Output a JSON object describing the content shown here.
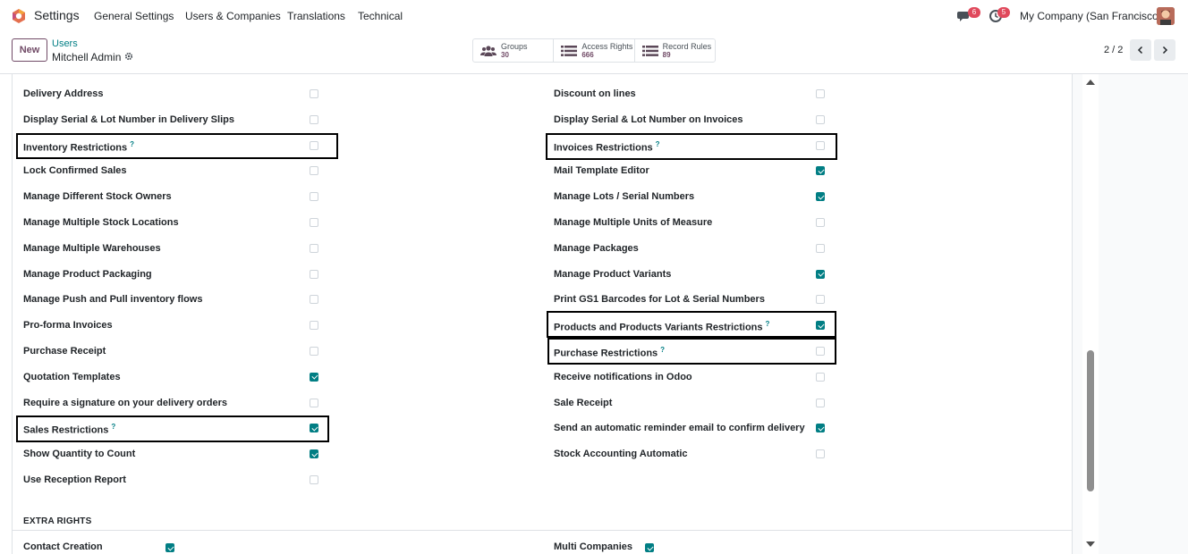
{
  "navbar": {
    "app_name": "Settings",
    "menu": [
      "General Settings",
      "Users & Companies",
      "Translations",
      "Technical"
    ],
    "messages_badge": "6",
    "activities_badge": "5",
    "company": "My Company (San Francisco)",
    "brand_color": "#714b67",
    "badge_color": "#e0495c"
  },
  "control_panel": {
    "new_label": "New",
    "breadcrumb": "Users",
    "record_name": "Mitchell Admin",
    "smart_buttons": [
      {
        "label": "Groups",
        "count": "30",
        "icon": "users-icon"
      },
      {
        "label": "Access Rights",
        "count": "666",
        "icon": "list-icon"
      },
      {
        "label": "Record Rules",
        "count": "89",
        "icon": "list-icon"
      }
    ],
    "pager": "2 / 2"
  },
  "accent_color": "#017e84",
  "left_fields": [
    {
      "label": "Delivery Address",
      "checked": false,
      "help": false
    },
    {
      "label": "Display Serial & Lot Number in Delivery Slips",
      "checked": false,
      "help": false
    },
    {
      "label": "Inventory Restrictions",
      "checked": false,
      "help": true
    },
    {
      "label": "Lock Confirmed Sales",
      "checked": false,
      "help": false
    },
    {
      "label": "Manage Different Stock Owners",
      "checked": false,
      "help": false
    },
    {
      "label": "Manage Multiple Stock Locations",
      "checked": false,
      "help": false
    },
    {
      "label": "Manage Multiple Warehouses",
      "checked": false,
      "help": false
    },
    {
      "label": "Manage Product Packaging",
      "checked": false,
      "help": false
    },
    {
      "label": "Manage Push and Pull inventory flows",
      "checked": false,
      "help": false
    },
    {
      "label": "Pro-forma Invoices",
      "checked": false,
      "help": false
    },
    {
      "label": "Purchase Receipt",
      "checked": false,
      "help": false
    },
    {
      "label": "Quotation Templates",
      "checked": true,
      "help": false
    },
    {
      "label": "Require a signature on your delivery orders",
      "checked": false,
      "help": false
    },
    {
      "label": "Sales Restrictions",
      "checked": true,
      "help": true
    },
    {
      "label": "Show Quantity to Count",
      "checked": true,
      "help": false
    },
    {
      "label": "Use Reception Report",
      "checked": false,
      "help": false
    }
  ],
  "right_fields": [
    {
      "label": "Discount on lines",
      "checked": false,
      "help": false
    },
    {
      "label": "Display Serial & Lot Number on Invoices",
      "checked": false,
      "help": false
    },
    {
      "label": "Invoices Restrictions",
      "checked": false,
      "help": true
    },
    {
      "label": "Mail Template Editor",
      "checked": true,
      "help": false
    },
    {
      "label": "Manage Lots / Serial Numbers",
      "checked": true,
      "help": false
    },
    {
      "label": "Manage Multiple Units of Measure",
      "checked": false,
      "help": false
    },
    {
      "label": "Manage Packages",
      "checked": false,
      "help": false
    },
    {
      "label": "Manage Product Variants",
      "checked": true,
      "help": false
    },
    {
      "label": "Print GS1 Barcodes for Lot & Serial Numbers",
      "checked": false,
      "help": false
    },
    {
      "label": "Products and Products Variants Restrictions",
      "checked": true,
      "help": true
    },
    {
      "label": "Purchase Restrictions",
      "checked": false,
      "help": true
    },
    {
      "label": "Receive notifications in Odoo",
      "checked": false,
      "help": false
    },
    {
      "label": "Sale Receipt",
      "checked": false,
      "help": false
    },
    {
      "label": "Send an automatic reminder email to confirm delivery",
      "checked": true,
      "help": false
    },
    {
      "label": "Stock Accounting Automatic",
      "checked": false,
      "help": false
    }
  ],
  "extra_rights": {
    "title": "EXTRA RIGHTS",
    "fields": [
      {
        "label": "Contact Creation",
        "checked": true
      },
      {
        "label": "Multi Companies",
        "checked": true
      }
    ]
  },
  "help_mark": "?"
}
